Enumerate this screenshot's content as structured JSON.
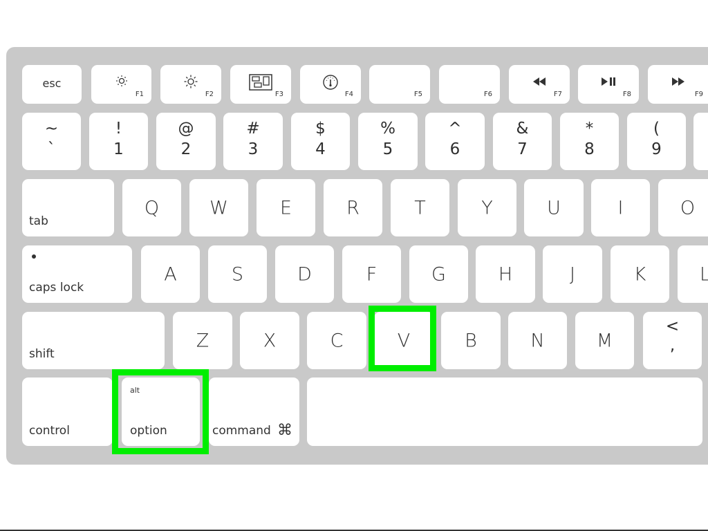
{
  "colors": {
    "keyboard_body": "#c9c9c9",
    "key_face": "#ffffff",
    "legend_text": "#2e2e2e",
    "highlight": "#00ee00"
  },
  "function_row": [
    {
      "label": "esc"
    },
    {
      "label": "F1",
      "icon": "brightness-down-icon"
    },
    {
      "label": "F2",
      "icon": "brightness-up-icon"
    },
    {
      "label": "F3",
      "icon": "mission-control-icon"
    },
    {
      "label": "F4",
      "icon": "dashboard-icon"
    },
    {
      "label": "F5"
    },
    {
      "label": "F6"
    },
    {
      "label": "F7",
      "icon": "rewind-icon",
      "glyph": "◀◀"
    },
    {
      "label": "F8",
      "icon": "play-pause-icon",
      "glyph": "▶II"
    },
    {
      "label": "F9",
      "icon": "fast-forward-icon",
      "glyph": "▶▶"
    }
  ],
  "number_row": [
    {
      "shift": "~",
      "base": "`"
    },
    {
      "shift": "!",
      "base": "1"
    },
    {
      "shift": "@",
      "base": "2"
    },
    {
      "shift": "#",
      "base": "3"
    },
    {
      "shift": "$",
      "base": "4"
    },
    {
      "shift": "%",
      "base": "5"
    },
    {
      "shift": "^",
      "base": "6"
    },
    {
      "shift": "&",
      "base": "7"
    },
    {
      "shift": "*",
      "base": "8"
    },
    {
      "shift": "(",
      "base": "9"
    }
  ],
  "qwerty_row": {
    "modifier": "tab",
    "letters": [
      "Q",
      "W",
      "E",
      "R",
      "T",
      "Y",
      "U",
      "I",
      "O"
    ]
  },
  "home_row": {
    "modifier": "caps lock",
    "letters": [
      "A",
      "S",
      "D",
      "F",
      "G",
      "H",
      "J",
      "K",
      "L"
    ]
  },
  "bottom_letter_row": {
    "modifier": "shift",
    "letters": [
      "Z",
      "X",
      "C",
      "V",
      "B",
      "N",
      "M"
    ],
    "punct": {
      "shift": "<",
      "base": ","
    }
  },
  "space_row": {
    "control": "control",
    "option": {
      "top": "alt",
      "label": "option"
    },
    "command": {
      "label": "command",
      "glyph": "⌘"
    }
  },
  "highlighted_keys": [
    "V",
    "option"
  ]
}
